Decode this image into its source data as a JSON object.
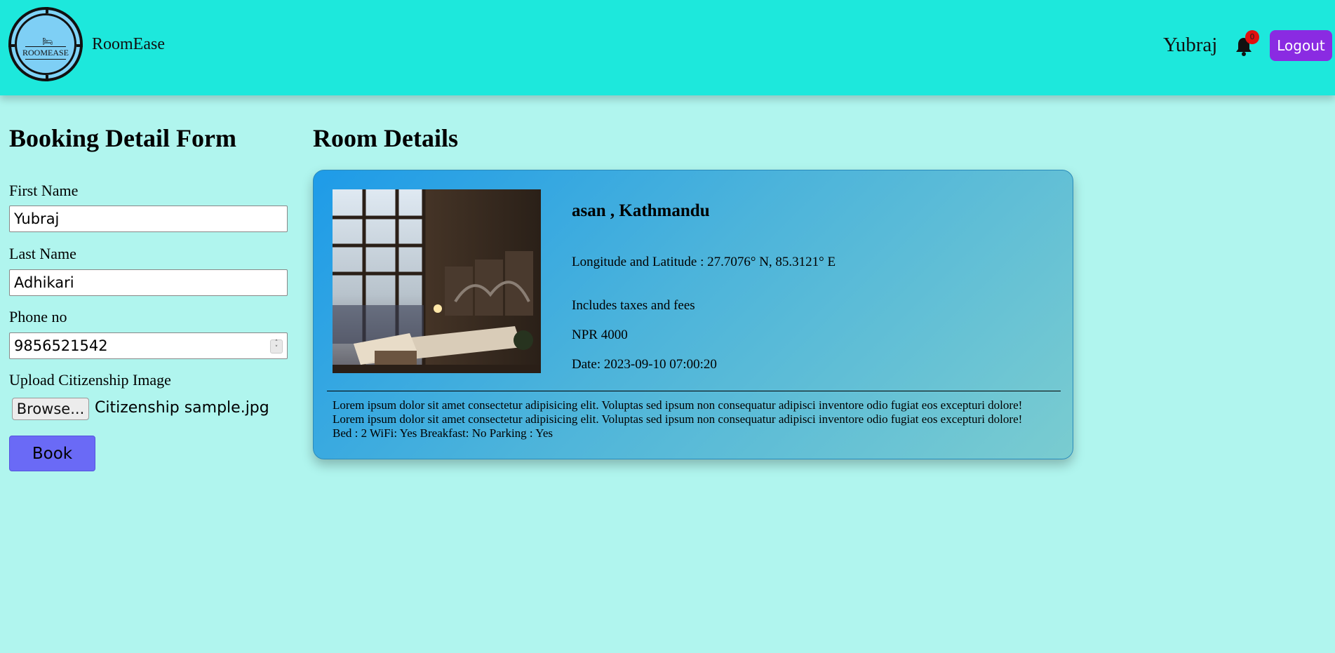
{
  "header": {
    "logo_text": "ROOMEASE",
    "brand": "RoomEase",
    "user_name": "Yubraj",
    "notification_count": "0",
    "logout_label": "Logout",
    "background_color": "#1de8dc"
  },
  "form": {
    "heading": "Booking Detail Form",
    "first_name_label": "First Name",
    "first_name_value": "Yubraj",
    "last_name_label": "Last Name",
    "last_name_value": "Adhikari",
    "phone_label": "Phone no",
    "phone_value": "9856521542",
    "upload_label": "Upload Citizenship Image",
    "browse_label": "Browse...",
    "file_name": "Citizenship sample.jpg",
    "book_label": "Book"
  },
  "room": {
    "heading": "Room Details",
    "title": "asan , Kathmandu",
    "coordinates": "Longitude and Latitude : 27.7076° N, 85.3121° E",
    "taxes_note": "Includes taxes and fees",
    "price": "NPR 4000",
    "date": "Date: 2023-09-10 07:00:20",
    "description_1": "Lorem ipsum dolor sit amet consectetur adipisicing elit. Voluptas sed ipsum non consequatur adipisci inventore odio fugiat eos excepturi dolore!",
    "description_2": "Lorem ipsum dolor sit amet consectetur adipisicing elit. Voluptas sed ipsum non consequatur adipisci inventore odio fugiat eos excepturi dolore!",
    "amenities": "Bed : 2 WiFi: Yes Breakfast: No Parking : Yes"
  },
  "colors": {
    "page_bg": "#b0f5ee",
    "logout_bg": "#8a2be2",
    "book_bg": "#6a6af6",
    "badge_bg": "#e01010"
  }
}
